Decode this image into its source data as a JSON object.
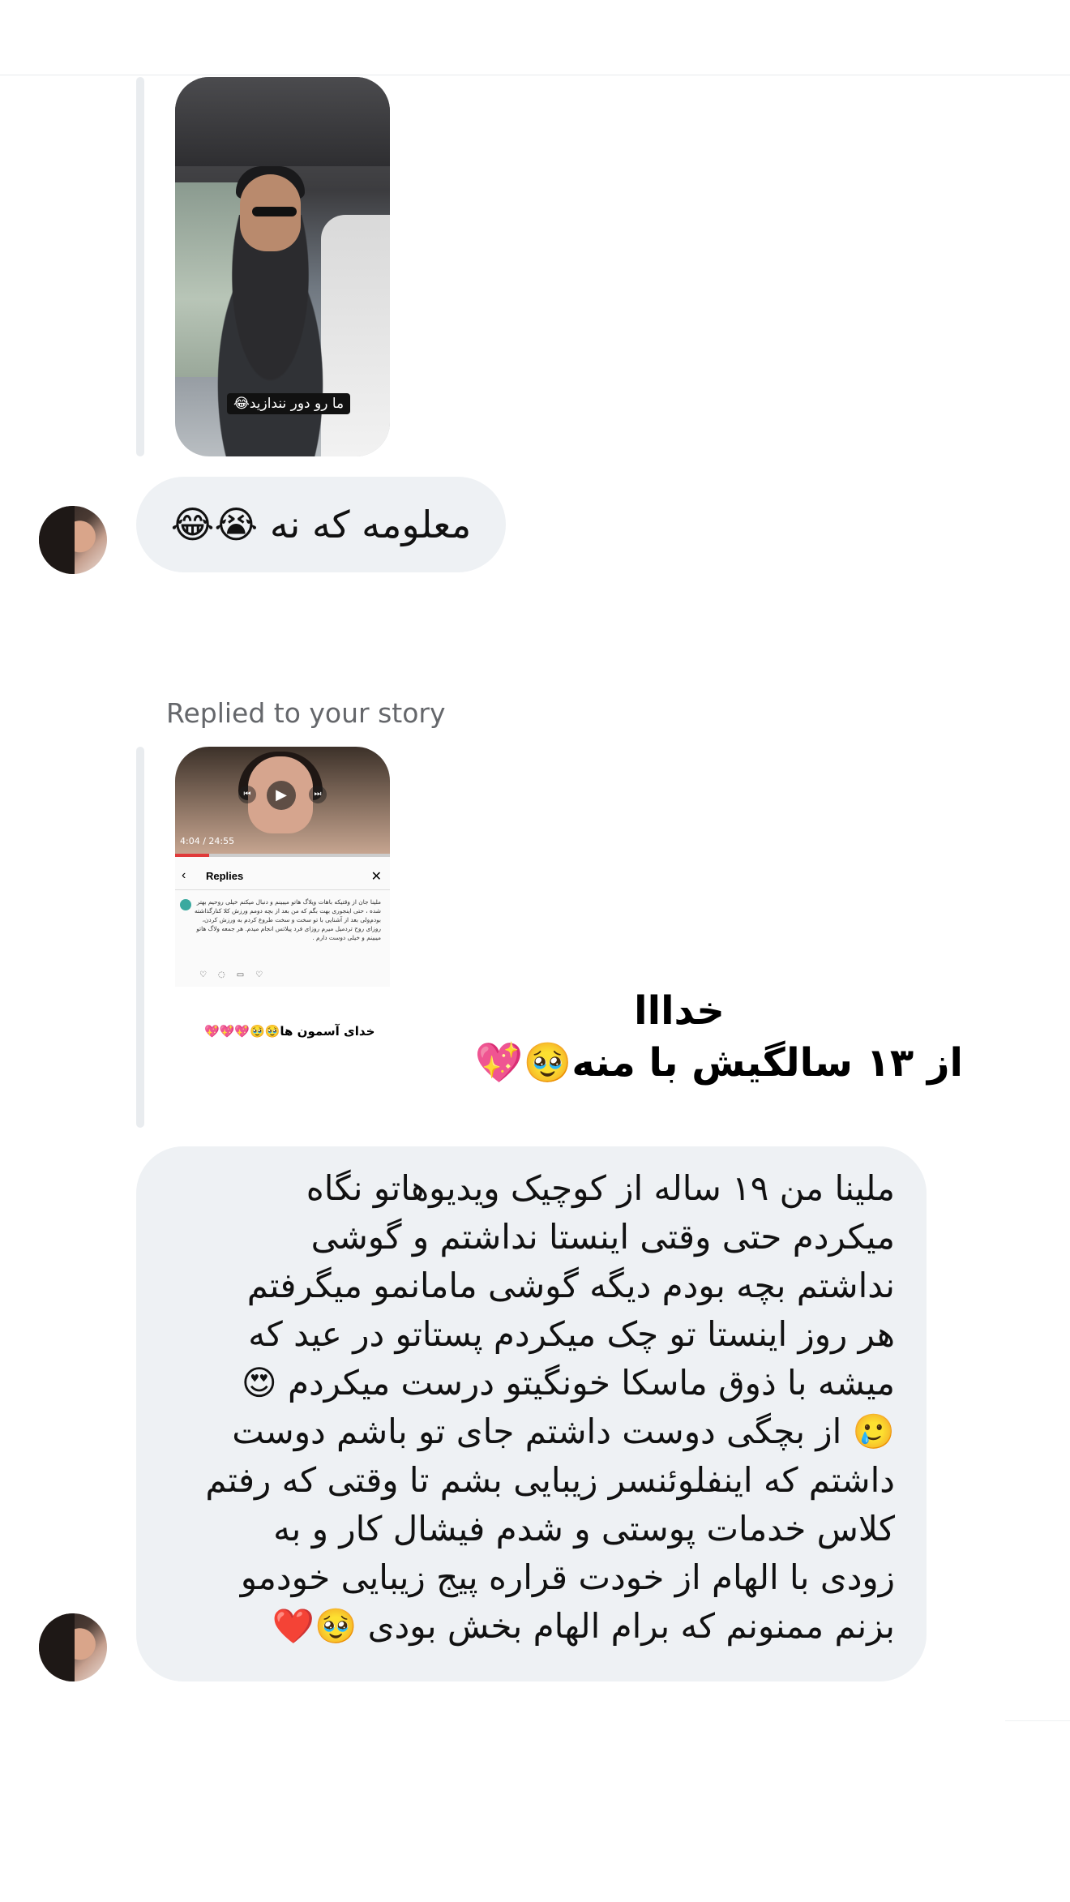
{
  "colors": {
    "bubble_bg": "#eef1f4",
    "quote_bar": "#e9ecef",
    "meta_text": "#65676b"
  },
  "messages": [
    {
      "type": "story_reply_media",
      "sticker_text": "ما رو دور نندازید😂"
    },
    {
      "type": "text",
      "sender": "them",
      "text": "معلومه که نه 😭😂"
    },
    {
      "type": "story_reply",
      "label": "Replied to your story",
      "thumbnail": {
        "timecode": "4:04 / 24:55",
        "progress": 0.16,
        "panel_title": "Replies",
        "comment_text": "ملینا جان از وقتیکه باهات ویلاگ هاتو میبینم و دنبال میکنم خیلی روحیم بهتر شده ، حتی اینجوری بهت بگم که من بعد از بچه دومم ورزش کلا کنارگذاشته بودم‌ولی بعد از آشنایی با تو سخت و سخت طروع کردم به ورزش کردن، روزای روح تردمیل میرم روزای فرد پیلاتس انجام میدم. هر جمعه ولاگ هاتو میبینم و خیلی دوست دارم .",
        "caption": "خدای آسمون ها🥹🥹💖💖💖"
      },
      "reply_line1": "خدااا",
      "reply_line2": "از ۱۳ سالگیش با منه🥹💖"
    },
    {
      "type": "text",
      "sender": "them",
      "text": "ملینا من ۱۹ ساله از کوچیک ویدیوهاتو نگاه\nمیکردم حتی وقتی اینستا نداشتم و گوشی\nنداشتم بچه بودم دیگه گوشی  مامانمو میگرفتم\nهر روز اینستا تو چک میکردم پستاتو در عید که\nمیشه با ذوق ماسکا خونگیتو درست میکردم 😍\n🥲 از بچگی دوست داشتم جای تو باشم دوست\nداشتم که اینفلوئنسر زیبایی بشم تا وقتی که رفتم\nکلاس خدمات پوستی و شدم فیشال کار و به\nزودی با الهام از خودت قراره پیج زیبایی خودمو\nبزنم ممنونم که برام الهام بخش بودی 🥹❤️"
    }
  ]
}
